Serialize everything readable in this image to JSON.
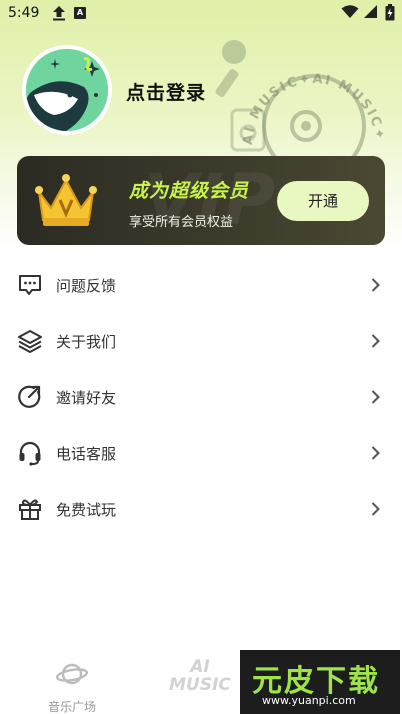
{
  "status_bar": {
    "time": "5:49",
    "a_badge": "A"
  },
  "profile": {
    "login_text": "点击登录"
  },
  "decoration": {
    "disc_text": "AI MUSIC✦AI MUSIC✦"
  },
  "vip": {
    "title": "成为超级会员",
    "subtitle": "享受所有会员权益",
    "button": "开通",
    "watermark": "VIP",
    "accent_color": "#c8f34d"
  },
  "menu": {
    "items": [
      {
        "label": "问题反馈",
        "icon": "feedback-icon"
      },
      {
        "label": "关于我们",
        "icon": "layers-icon"
      },
      {
        "label": "邀请好友",
        "icon": "invite-icon"
      },
      {
        "label": "电话客服",
        "icon": "headset-icon"
      },
      {
        "label": "免费试玩",
        "icon": "gift-icon"
      }
    ]
  },
  "bottom_nav": {
    "plaza_label": "音乐广场",
    "ai_line1": "AI",
    "ai_line2": "MUSIC"
  },
  "watermark": {
    "title": "元皮下载",
    "url": "www.yuanpi.com"
  }
}
